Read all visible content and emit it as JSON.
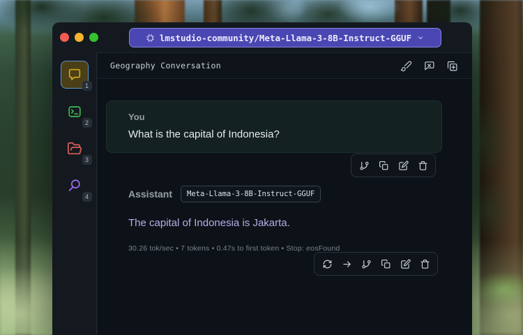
{
  "titlebar": {
    "model_selector_label": "lmstudio-community/Meta-Llama-3-8B-Instruct-GGUF"
  },
  "sidebar": {
    "chat_badge": "1",
    "developer_badge": "2",
    "models_badge": "3",
    "discover_badge": "4"
  },
  "header": {
    "title": "Geography Conversation"
  },
  "messages": {
    "user": {
      "role_label": "You",
      "text": "What is the capital of Indonesia?"
    },
    "assistant": {
      "role_label": "Assistant",
      "model_badge": "Meta-Llama-3-8B-Instruct-GGUF",
      "text": "The capital of Indonesia is Jakarta.",
      "stats_line": "30.26 tok/sec  •  7 tokens  •  0.47s to first token  •  Stop: eosFound",
      "stats": {
        "tok_per_sec": "30.26 tok/sec",
        "tokens": "7 tokens",
        "time_to_first_token": "0.47s to first token",
        "stop_reason": "Stop: eosFound"
      }
    }
  },
  "icons": {
    "model_selector": "chip-icon",
    "model_selector_chevron": "chevron-down-icon",
    "sidebar": [
      "chat-bubble-icon",
      "terminal-icon",
      "folder-open-icon",
      "search-icon"
    ],
    "header_actions": [
      "broom-icon",
      "clear-conversation-icon",
      "duplicate-icon"
    ],
    "user_message_actions": [
      "branch-icon",
      "copy-icon",
      "edit-icon",
      "trash-icon"
    ],
    "assistant_message_actions": [
      "regenerate-icon",
      "continue-arrow-icon",
      "branch-icon",
      "copy-icon",
      "edit-icon",
      "trash-icon"
    ]
  },
  "colors": {
    "model_pill_bg": "#4a47b3",
    "model_pill_border": "#8784de",
    "chat_icon": "#d4aa20",
    "developer_icon": "#3fb950",
    "models_icon": "#e0635a",
    "discover_icon": "#a371f7",
    "assistant_text": "#b3aee6",
    "traffic_red": "#f25c54",
    "traffic_yellow": "#f3b42c",
    "traffic_green": "#35c32f"
  }
}
